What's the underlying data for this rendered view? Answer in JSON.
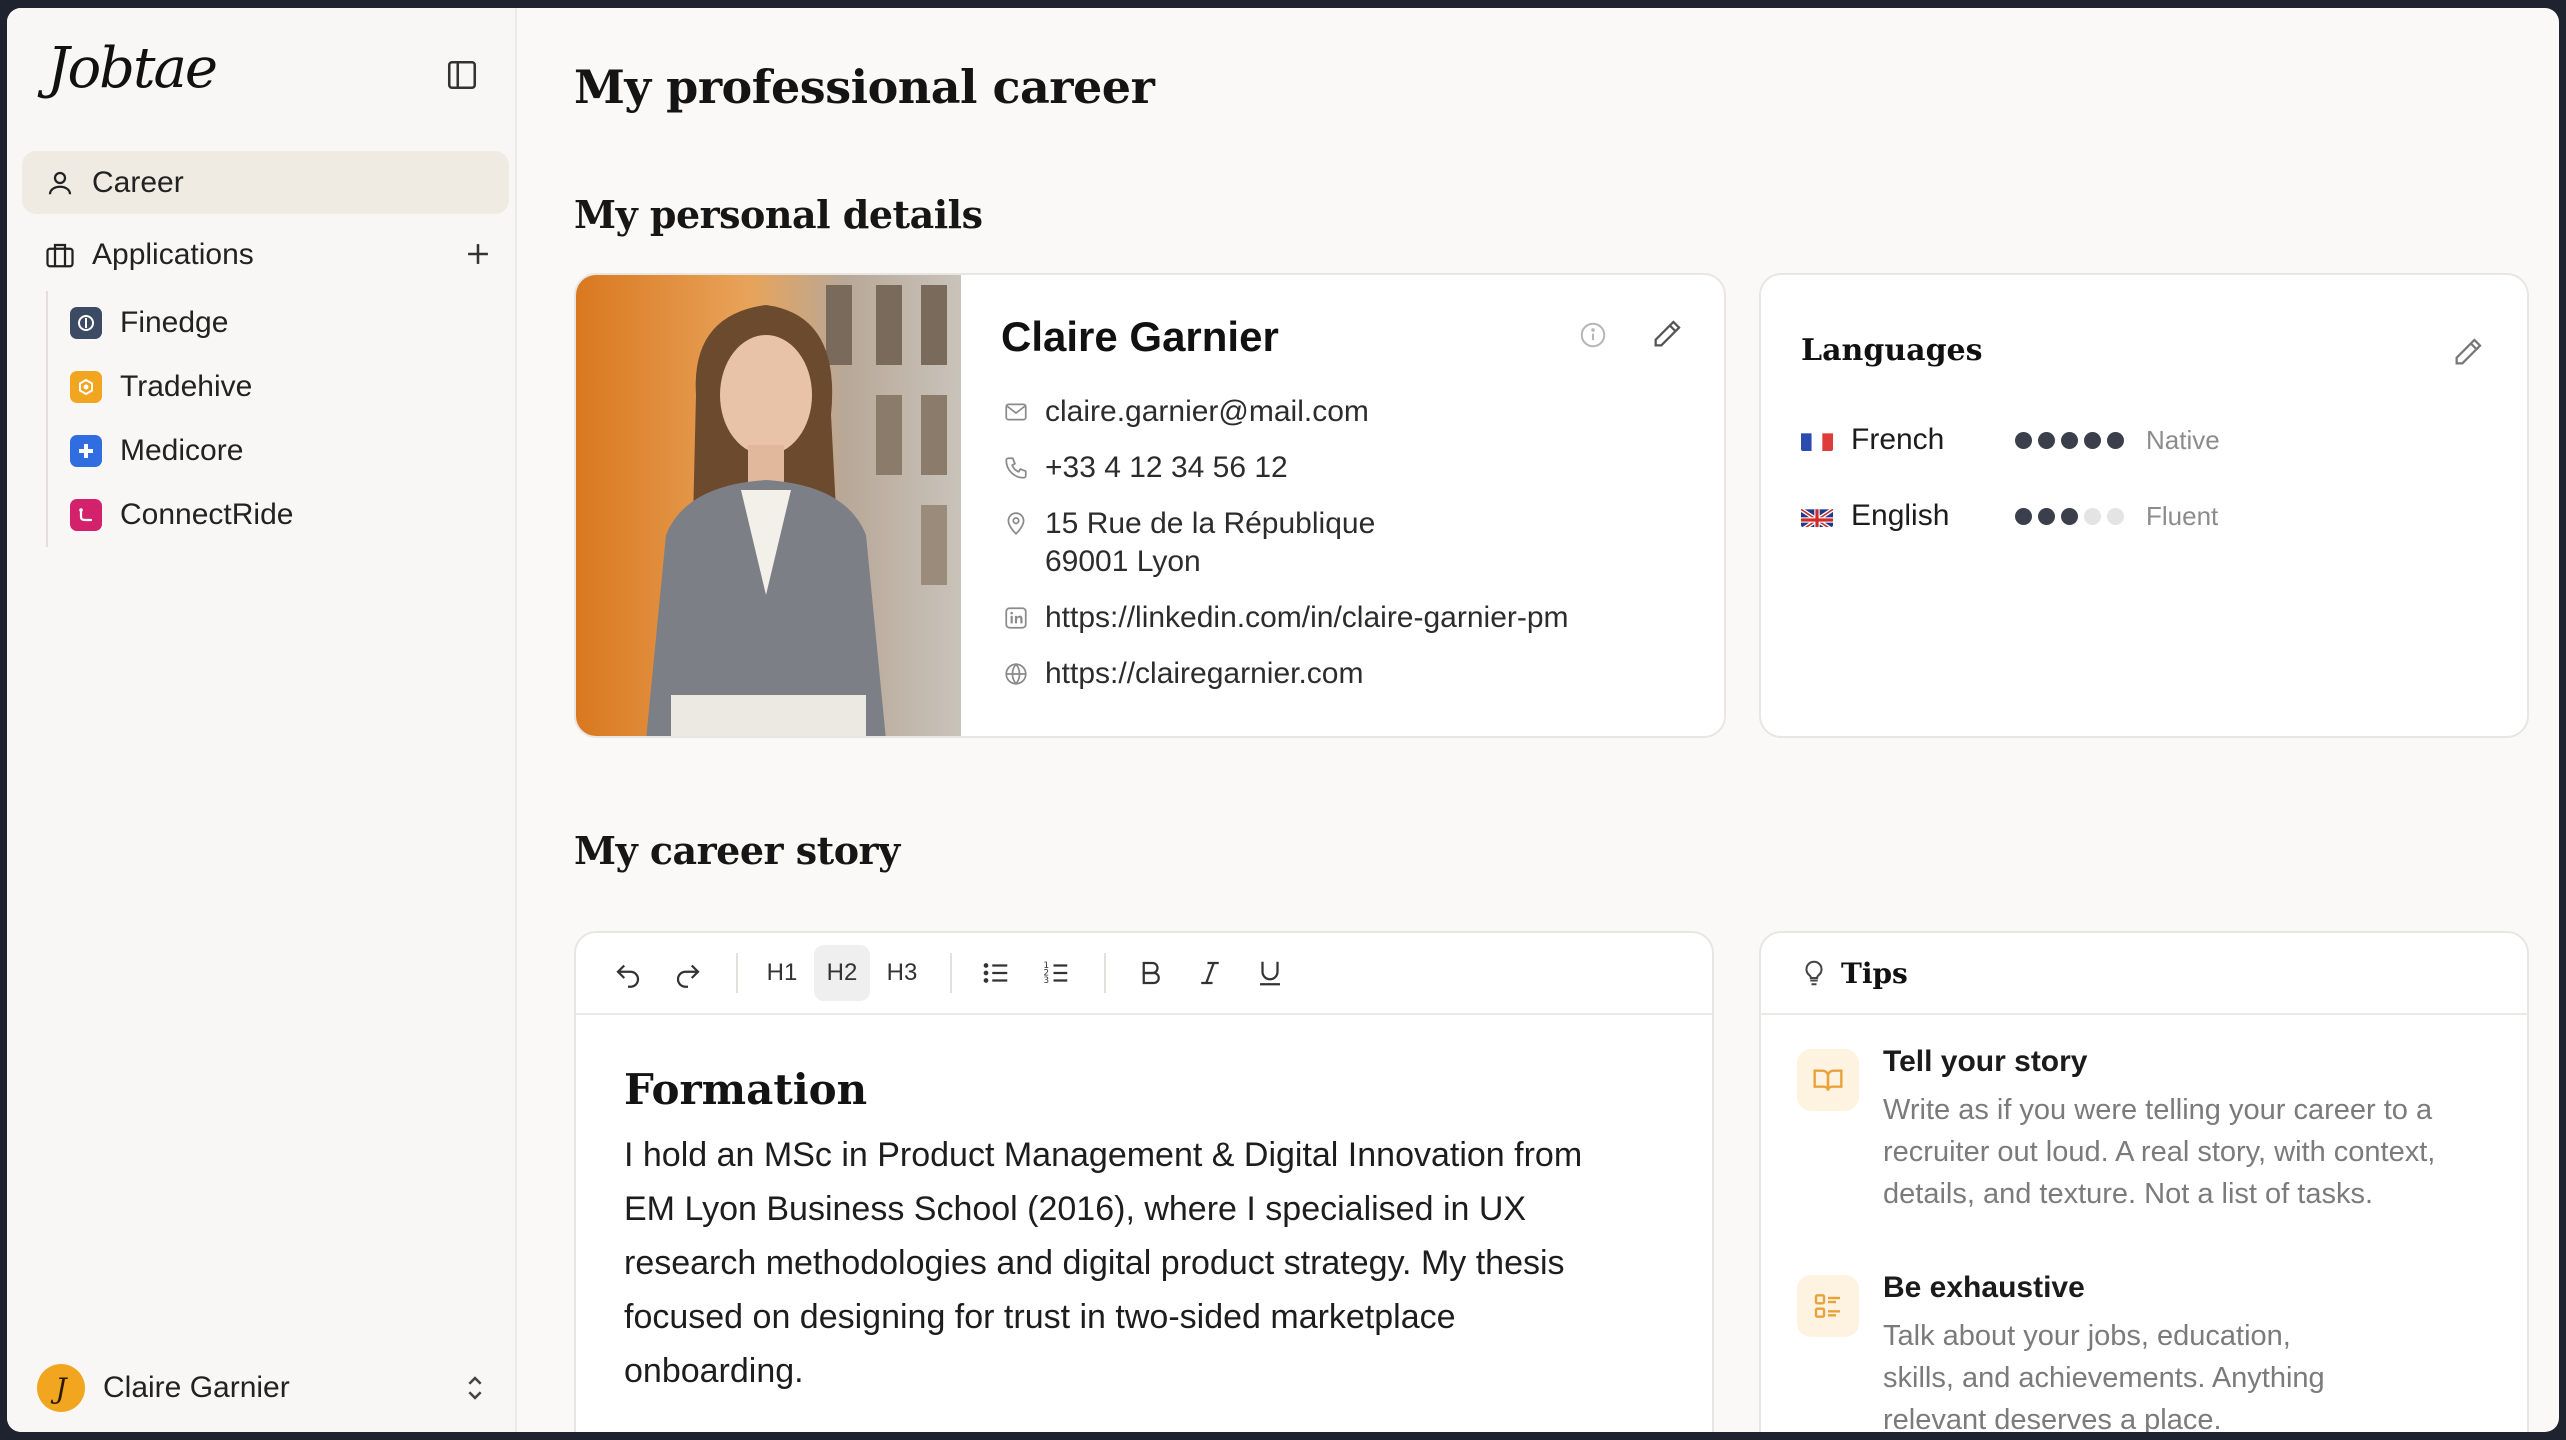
{
  "app": {
    "logo": "Jobtae"
  },
  "sidebar": {
    "nav": [
      {
        "label": "Career"
      },
      {
        "label": "Applications"
      }
    ],
    "applications": [
      {
        "label": "Finedge",
        "color": "#3d4a63"
      },
      {
        "label": "Tradehive",
        "color": "#f2a51e"
      },
      {
        "label": "Medicore",
        "color": "#2f6de1"
      },
      {
        "label": "ConnectRide",
        "color": "#d3226b"
      }
    ],
    "user": {
      "name": "Claire Garnier",
      "initial": "J"
    }
  },
  "page": {
    "title": "My professional career",
    "personal_title": "My personal details",
    "career_title": "My career story"
  },
  "profile": {
    "name": "Claire Garnier",
    "email": "claire.garnier@mail.com",
    "phone": "+33 4 12 34 56 12",
    "address_line1": "15 Rue de la République",
    "address_line2": "69001 Lyon",
    "linkedin": "https://linkedin.com/in/claire-garnier-pm",
    "website": "https://clairegarnier.com"
  },
  "languages": {
    "title": "Languages",
    "items": [
      {
        "name": "French",
        "level": "Native",
        "dots": 5
      },
      {
        "name": "English",
        "level": "Fluent",
        "dots": 3
      }
    ]
  },
  "editor": {
    "toolbar": {
      "h1": "H1",
      "h2": "H2",
      "h3": "H3"
    },
    "heading": "Formation",
    "paragraph_lines": [
      "I hold an MSc in Product Management & Digital Innovation from",
      "EM Lyon Business School (2016), where I specialised in UX",
      "research methodologies and digital product strategy. My thesis",
      "focused on designing for trust in two-sided marketplace",
      "onboarding."
    ]
  },
  "tips": {
    "title": "Tips",
    "items": [
      {
        "title": "Tell your story",
        "lines": [
          "Write as if you were telling your career to a",
          "recruiter out loud. A real story, with context,",
          "details, and texture. Not a list of tasks."
        ]
      },
      {
        "title": "Be exhaustive",
        "lines": [
          "Talk about your jobs, education,",
          "skills, and achievements. Anything",
          "relevant deserves a place."
        ]
      }
    ]
  },
  "colors": {
    "accent": "#f2a51e",
    "active_nav": "#efebe2",
    "dot_on": "#3a3f4b",
    "dot_off": "#e4e4e4"
  }
}
